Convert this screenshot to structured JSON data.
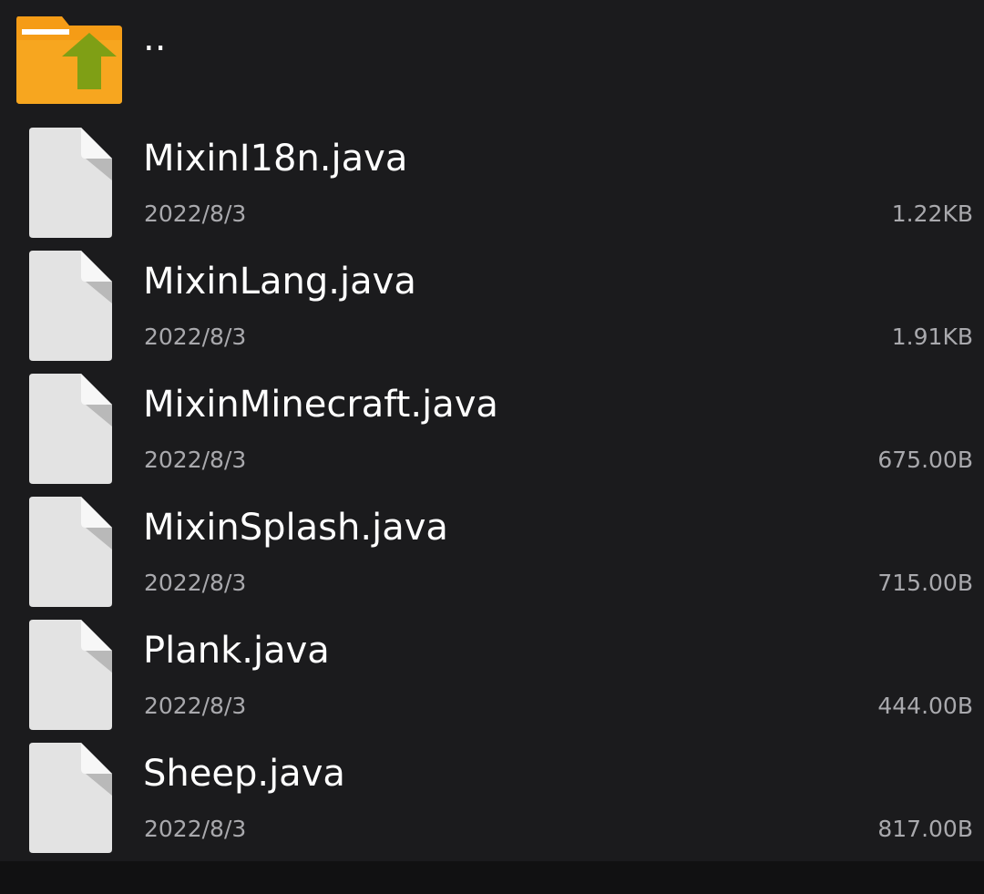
{
  "parent": {
    "label": "..",
    "icon": "folder-up-icon"
  },
  "files": [
    {
      "name": "MixinI18n.java",
      "date": "2022/8/3",
      "size": "1.22KB",
      "icon": "file-icon"
    },
    {
      "name": "MixinLang.java",
      "date": "2022/8/3",
      "size": "1.91KB",
      "icon": "file-icon"
    },
    {
      "name": "MixinMinecraft.java",
      "date": "2022/8/3",
      "size": "675.00B",
      "icon": "file-icon"
    },
    {
      "name": "MixinSplash.java",
      "date": "2022/8/3",
      "size": "715.00B",
      "icon": "file-icon"
    },
    {
      "name": "Plank.java",
      "date": "2022/8/3",
      "size": "444.00B",
      "icon": "file-icon"
    },
    {
      "name": "Sheep.java",
      "date": "2022/8/3",
      "size": "817.00B",
      "icon": "file-icon"
    }
  ],
  "colors": {
    "background": "#1b1b1d",
    "folder": "#f7a21b",
    "arrow": "#7fa116",
    "file": "#e3e3e3",
    "secondary_text": "#a9a9ad"
  }
}
